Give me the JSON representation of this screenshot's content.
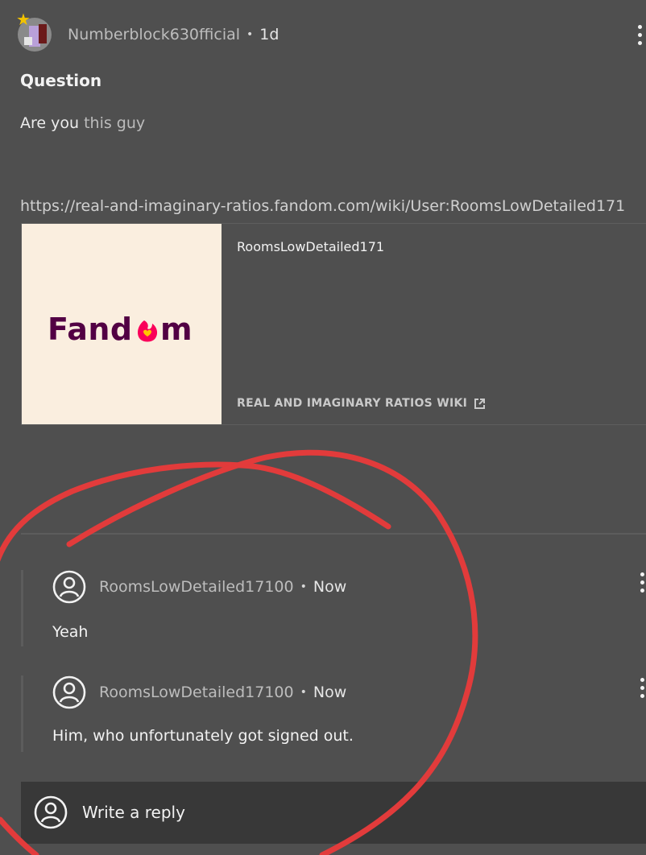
{
  "post": {
    "author": "Numberblock630fficial",
    "separator": "•",
    "time": "1d",
    "title": "Question",
    "body_prefix": "Are you",
    "body_muted": " this guy",
    "url": "https://real-and-imaginary-ratios.fandom.com/wiki/User:RoomsLowDetailed171",
    "card": {
      "logo_text": "Fandom",
      "title": "RoomsLowDetailed171",
      "site": "REAL AND IMAGINARY RATIOS WIKI"
    }
  },
  "replies": [
    {
      "author": "RoomsLowDetailed17100",
      "separator": "•",
      "time": "Now",
      "text": "Yeah"
    },
    {
      "author": "RoomsLowDetailed17100",
      "separator": "•",
      "time": "Now",
      "text": "Him, who unfortunately got signed out."
    }
  ],
  "composer": {
    "placeholder": "Write a reply"
  },
  "icons": {
    "kebab": "more-options-icon",
    "user": "user-avatar-icon",
    "external": "external-link-icon",
    "star": "star-badge-icon"
  },
  "colors": {
    "background": "#4f4f4f",
    "annotation": "#e23b3b",
    "fandom_brand": "#520044",
    "fandom_flame": "#fa005a"
  }
}
